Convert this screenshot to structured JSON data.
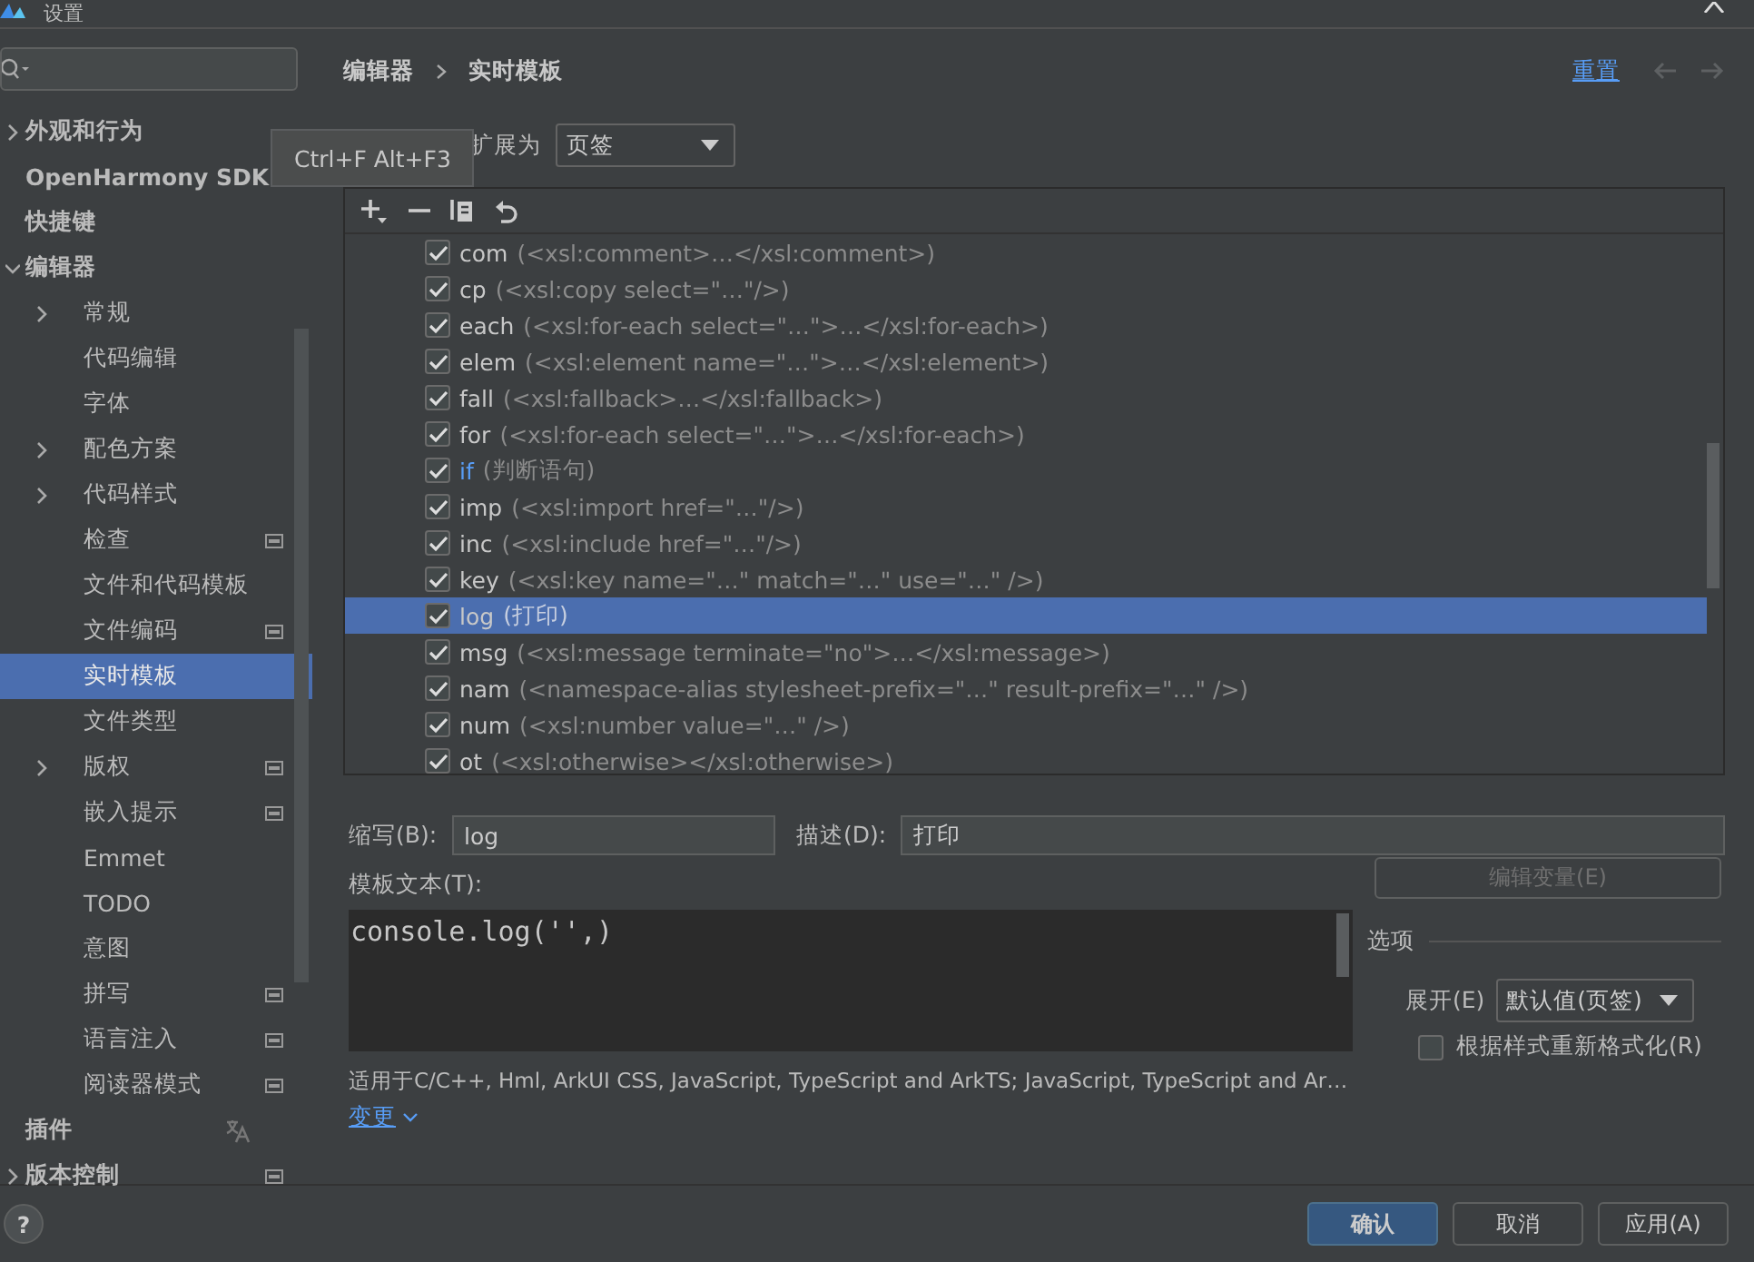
{
  "window": {
    "title": "设置"
  },
  "sidebar": {
    "items": [
      {
        "label": "外观和行为",
        "expanded": false
      },
      {
        "label": "OpenHarmony SDK"
      },
      {
        "label": "快捷键"
      },
      {
        "label": "编辑器",
        "expanded": true,
        "children": [
          {
            "label": "常规",
            "expanded": false
          },
          {
            "label": "代码编辑"
          },
          {
            "label": "字体"
          },
          {
            "label": "配色方案",
            "expanded": false
          },
          {
            "label": "代码样式",
            "expanded": false
          },
          {
            "label": "检查",
            "scoped": true
          },
          {
            "label": "文件和代码模板"
          },
          {
            "label": "文件编码",
            "scoped": true
          },
          {
            "label": "实时模板",
            "selected": true
          },
          {
            "label": "文件类型"
          },
          {
            "label": "版权",
            "expanded": false,
            "scoped": true
          },
          {
            "label": "嵌入提示",
            "scoped": true
          },
          {
            "label": "Emmet"
          },
          {
            "label": "TODO"
          },
          {
            "label": "意图"
          },
          {
            "label": "拼写",
            "scoped": true
          },
          {
            "label": "语言注入",
            "scoped": true
          },
          {
            "label": "阅读器模式",
            "scoped": true
          }
        ]
      },
      {
        "label": "插件",
        "translatable": true
      },
      {
        "label": "版本控制",
        "expanded": false,
        "scoped": true
      }
    ]
  },
  "tooltip": "Ctrl+F Alt+F3",
  "breadcrumb": [
    "编辑器",
    "实时模板"
  ],
  "reset_link": "重置",
  "expand_with": {
    "label": "扩展为",
    "value": "页签"
  },
  "templates": [
    {
      "key": "com",
      "description": "(<xsl:comment>…</xsl:comment>)",
      "checked": true,
      "modified": false,
      "selected": false
    },
    {
      "key": "cp",
      "description": "(<xsl:copy select=\"…\"/>)",
      "checked": true,
      "modified": false,
      "selected": false
    },
    {
      "key": "each",
      "description": "(<xsl:for-each select=\"…\">…</xsl:for-each>)",
      "checked": true,
      "modified": false,
      "selected": false
    },
    {
      "key": "elem",
      "description": "(<xsl:element name=\"…\">…</xsl:element>)",
      "checked": true,
      "modified": false,
      "selected": false
    },
    {
      "key": "fall",
      "description": "(<xsl:fallback>…</xsl:fallback>)",
      "checked": true,
      "modified": false,
      "selected": false
    },
    {
      "key": "for",
      "description": "(<xsl:for-each select=\"…\">…</xsl:for-each>)",
      "checked": true,
      "modified": false,
      "selected": false
    },
    {
      "key": "if",
      "description": "(判断语句)",
      "checked": true,
      "modified": true,
      "selected": false
    },
    {
      "key": "imp",
      "description": "(<xsl:import href=\"…\"/>)",
      "checked": true,
      "modified": false,
      "selected": false
    },
    {
      "key": "inc",
      "description": "(<xsl:include href=\"…\"/>)",
      "checked": true,
      "modified": false,
      "selected": false
    },
    {
      "key": "key",
      "description": "(<xsl:key name=\"…\" match=\"…\" use=\"…\" />)",
      "checked": true,
      "modified": false,
      "selected": false
    },
    {
      "key": "log",
      "description": "(打印)",
      "checked": true,
      "modified": false,
      "selected": true
    },
    {
      "key": "msg",
      "description": "(<xsl:message terminate=\"no\">…</xsl:message>)",
      "checked": true,
      "modified": false,
      "selected": false
    },
    {
      "key": "nam",
      "description": "(<namespace-alias stylesheet-prefix=\"…\" result-prefix=\"…\" />)",
      "checked": true,
      "modified": false,
      "selected": false
    },
    {
      "key": "num",
      "description": "(<xsl:number value=\"…\" />)",
      "checked": true,
      "modified": false,
      "selected": false
    },
    {
      "key": "ot",
      "description": "(<xsl:otherwise></xsl:otherwise>)",
      "checked": true,
      "modified": false,
      "selected": false
    }
  ],
  "form": {
    "abbreviation": {
      "label": "缩写(B):",
      "value": "log"
    },
    "description": {
      "label": "描述(D):",
      "value": "打印"
    },
    "template_text": {
      "label": "模板文本(T):",
      "value": "console.log('',)"
    },
    "edit_variables": {
      "label": "编辑变量(E)",
      "disabled": true
    },
    "options": {
      "title": "选项",
      "expand": {
        "label": "展开(E)",
        "value": "默认值(页签)"
      },
      "reformat": {
        "label": "根据样式重新格式化(R)",
        "checked": false
      }
    },
    "applicable": "适用于C/C++, Hml, ArkUI CSS, JavaScript, TypeScript and ArkTS; JavaScript, TypeScript and Ar…",
    "change_link": "变更"
  },
  "help_button": "?",
  "buttons": [
    {
      "label": "确认",
      "primary": true
    },
    {
      "label": "取消",
      "primary": false
    },
    {
      "label": "应用(A)",
      "primary": false
    }
  ]
}
